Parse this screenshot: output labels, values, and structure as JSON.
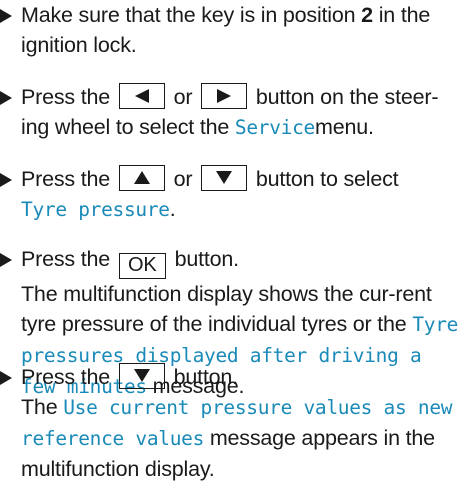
{
  "steps": [
    {
      "part1": "Make sure that the key is in position ",
      "position": "2",
      "part2": " in the ignition lock."
    },
    {
      "pre": "Press the ",
      "left_key_icon": "left-triangle",
      "mid": " or ",
      "right_key_icon": "right-triangle",
      "post": " button on the steer-ing wheel to select the ",
      "highlight": "Service",
      "end": "menu."
    },
    {
      "pre": "Press the ",
      "up_key_icon": "up-triangle",
      "mid": " or ",
      "down_key_icon": "down-triangle",
      "post": " button to select ",
      "highlight": "Tyre pressure",
      "end": "."
    },
    {
      "pre": "Press the ",
      "key_label": "OK",
      "post": " button.",
      "desc_pre": "The multifunction display shows the cur-rent tyre pressure of the individual tyres or the ",
      "desc_highlight": "Tyre pressures displayed after driving a few minutes",
      "desc_post": " message."
    },
    {
      "pre": "Press the ",
      "down_key_icon": "down-triangle",
      "post": " button.",
      "desc_pre": "The ",
      "desc_highlight": "Use current pressure values as new reference values",
      "desc_post": " message appears in the multifunction display."
    }
  ]
}
